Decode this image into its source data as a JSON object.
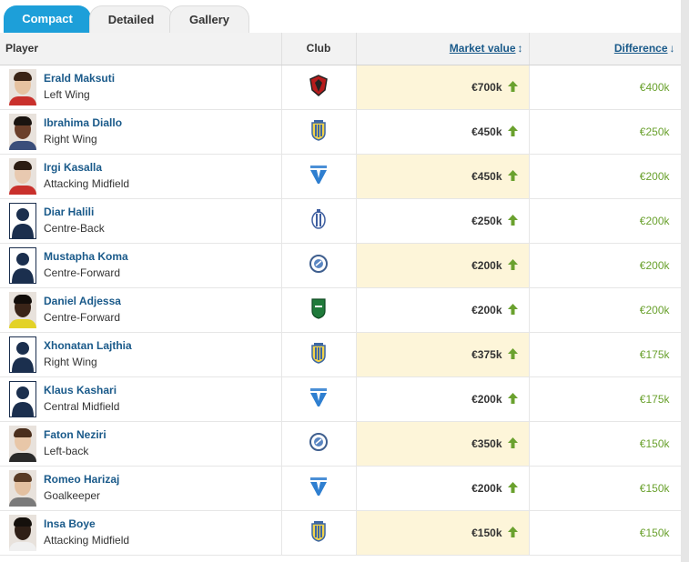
{
  "tabs": [
    {
      "label": "Compact",
      "active": true
    },
    {
      "label": "Detailed",
      "active": false
    },
    {
      "label": "Gallery",
      "active": false
    }
  ],
  "columns": {
    "player": "Player",
    "club": "Club",
    "market_value": "Market value",
    "market_value_sort_icon": "↕",
    "difference": "Difference",
    "difference_sort_icon": "↓"
  },
  "colors": {
    "tab_active": "#1d9fd9",
    "link": "#1a5a8a",
    "positive": "#6aa12e",
    "highlight_column": "#fdf5d9"
  },
  "rows": [
    {
      "name": "Erald Maksuti",
      "position": "Left Wing",
      "club_icon": "red-black-crest-icon",
      "market_value": "€700k",
      "trend": "up-arrow-icon",
      "difference": "€400k",
      "avatar": "photo"
    },
    {
      "name": "Ibrahima Diallo",
      "position": "Right Wing",
      "club_icon": "blue-yellow-striped-crest-icon",
      "market_value": "€450k",
      "trend": "up-arrow-icon",
      "difference": "€250k",
      "avatar": "photo"
    },
    {
      "name": "Irgi Kasalla",
      "position": "Attacking Midfield",
      "club_icon": "blue-v-crest-icon",
      "market_value": "€450k",
      "trend": "up-arrow-icon",
      "difference": "€200k",
      "avatar": "photo"
    },
    {
      "name": "Diar Halili",
      "position": "Centre-Back",
      "club_icon": "blue-white-striped-crest-icon",
      "market_value": "€250k",
      "trend": "up-arrow-icon",
      "difference": "€200k",
      "avatar": "silhouette"
    },
    {
      "name": "Mustapha Koma",
      "position": "Centre-Forward",
      "club_icon": "round-blue-crest-icon",
      "market_value": "€200k",
      "trend": "up-arrow-icon",
      "difference": "€200k",
      "avatar": "silhouette"
    },
    {
      "name": "Daniel Adjessa",
      "position": "Centre-Forward",
      "club_icon": "green-crest-icon",
      "market_value": "€200k",
      "trend": "up-arrow-icon",
      "difference": "€200k",
      "avatar": "photo"
    },
    {
      "name": "Xhonatan Lajthia",
      "position": "Right Wing",
      "club_icon": "blue-yellow-striped-crest-icon",
      "market_value": "€375k",
      "trend": "up-arrow-icon",
      "difference": "€175k",
      "avatar": "silhouette"
    },
    {
      "name": "Klaus Kashari",
      "position": "Central Midfield",
      "club_icon": "blue-v-crest-icon",
      "market_value": "€200k",
      "trend": "up-arrow-icon",
      "difference": "€175k",
      "avatar": "silhouette"
    },
    {
      "name": "Faton Neziri",
      "position": "Left-back",
      "club_icon": "round-blue-crest-icon",
      "market_value": "€350k",
      "trend": "up-arrow-icon",
      "difference": "€150k",
      "avatar": "photo"
    },
    {
      "name": "Romeo Harizaj",
      "position": "Goalkeeper",
      "club_icon": "blue-v-crest-icon",
      "market_value": "€200k",
      "trend": "up-arrow-icon",
      "difference": "€150k",
      "avatar": "photo"
    },
    {
      "name": "Insa Boye",
      "position": "Attacking Midfield",
      "club_icon": "blue-yellow-striped-crest-icon",
      "market_value": "€150k",
      "trend": "up-arrow-icon",
      "difference": "€150k",
      "avatar": "photo"
    }
  ]
}
